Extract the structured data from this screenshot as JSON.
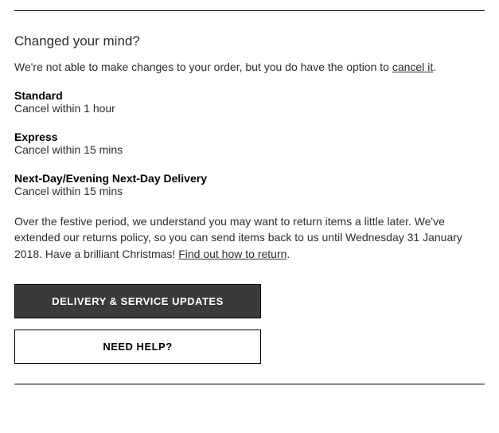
{
  "heading": "Changed your mind?",
  "intro_prefix": "We're not able to make changes to your order, but you do have the option to ",
  "intro_link": "cancel it",
  "intro_suffix": ".",
  "options": [
    {
      "title": "Standard",
      "desc": "Cancel within 1 hour"
    },
    {
      "title": "Express",
      "desc": "Cancel within 15 mins"
    },
    {
      "title": "Next-Day/Evening Next-Day Delivery",
      "desc": "Cancel within 15 mins"
    }
  ],
  "returns_prefix": "Over the festive period, we understand you may want to return items a little later. We've extended our returns policy, so you can send items back to us until Wednesday 31 January 2018. Have a brilliant Christmas! ",
  "returns_link": "Find out how to return",
  "returns_suffix": ".",
  "buttons": {
    "delivery_updates": "DELIVERY & SERVICE UPDATES",
    "need_help": "NEED HELP?"
  }
}
